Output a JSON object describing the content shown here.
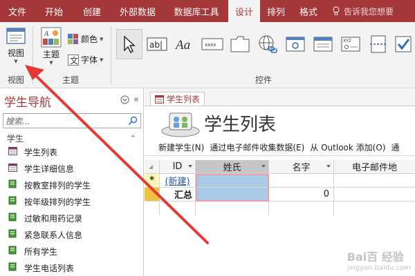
{
  "menu": {
    "tabs": [
      "文件",
      "开始",
      "创建",
      "外部数据",
      "数据库工具",
      "设计",
      "排列",
      "格式"
    ],
    "active_tab": "设计",
    "tell_me": "告诉我您想要"
  },
  "ribbon": {
    "views_group_label": "视图",
    "view_button": "视图",
    "theme_group_label": "主题",
    "theme_button": "主题",
    "colors_button": "颜色",
    "fonts_button": "字体",
    "controls_group_label": "控件"
  },
  "nav": {
    "title": "学生导航",
    "search_placeholder": "搜索...",
    "section": "学生",
    "items": [
      {
        "label": "学生列表",
        "icon": "form-icon"
      },
      {
        "label": "学生详细信息",
        "icon": "form-icon"
      },
      {
        "label": "按教室排列的学生",
        "icon": "report-icon"
      },
      {
        "label": "按年级排列的学生",
        "icon": "report-icon"
      },
      {
        "label": "过敏和用药记录",
        "icon": "report-icon"
      },
      {
        "label": "紧急联系人信息",
        "icon": "report-icon"
      },
      {
        "label": "所有学生",
        "icon": "report-icon"
      },
      {
        "label": "学生电话列表",
        "icon": "report-icon"
      }
    ]
  },
  "document": {
    "tab_label": "学生列表",
    "form_title": "学生列表",
    "toolbar": {
      "new_student": "新建学生(N)",
      "collect_email": "通过电子邮件收集数据(E)",
      "outlook_add": "从 Outlook 添加(O)",
      "more": "通"
    },
    "grid": {
      "columns": [
        "ID",
        "姓氏",
        "名字",
        "电子邮件地"
      ],
      "new_row_marker": "*",
      "new_row_label": "(新建)",
      "total_row_label": "汇总",
      "total_value": "0"
    }
  },
  "watermark": {
    "main": "Bai百 经验",
    "sub": "jingyan.baidu.com"
  },
  "colors": {
    "accent": "#a4373a",
    "selection": "#a9cbe8",
    "highlight_border": "#e8a0a8",
    "arrow": "#e53935"
  }
}
